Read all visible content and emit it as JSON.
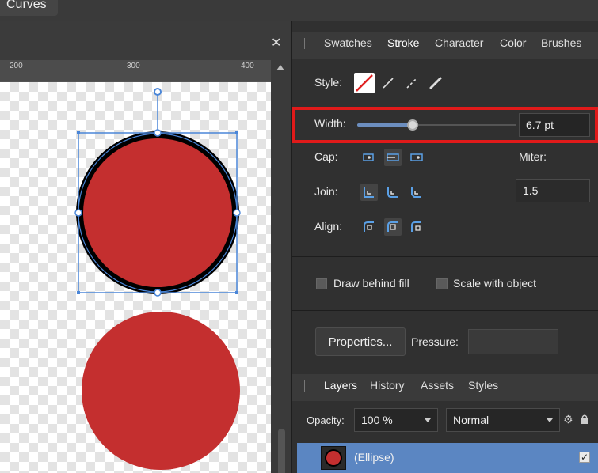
{
  "top_tab": {
    "label": "Curves"
  },
  "ruler": {
    "ticks": [
      "200",
      "300",
      "400"
    ]
  },
  "panel_tabs": [
    {
      "label": "Swatches"
    },
    {
      "label": "Stroke"
    },
    {
      "label": "Character"
    },
    {
      "label": "Color"
    },
    {
      "label": "Brushes"
    }
  ],
  "stroke": {
    "style_label": "Style:",
    "width_label": "Width:",
    "width_value": "6.7 pt",
    "width_fraction": 0.35,
    "cap_label": "Cap:",
    "miter_label": "Miter:",
    "join_label": "Join:",
    "miter_value": "1.5",
    "align_label": "Align:",
    "draw_behind_label": "Draw behind fill",
    "scale_label": "Scale with object",
    "properties_label": "Properties...",
    "pressure_label": "Pressure:"
  },
  "layers_tabs": [
    {
      "label": "Layers"
    },
    {
      "label": "History"
    },
    {
      "label": "Assets"
    },
    {
      "label": "Styles"
    }
  ],
  "layers": {
    "opacity_label": "Opacity:",
    "opacity_value": "100 %",
    "blend_mode": "Normal",
    "items": [
      {
        "name": "(Ellipse)",
        "visible": true
      }
    ]
  },
  "colors": {
    "fill_red": "#c42f2f",
    "selection_blue": "#4a86d8",
    "highlight_red": "#e01a1a"
  },
  "icons": [
    "close-icon",
    "none-stroke-icon",
    "solid-line-icon",
    "dashed-line-icon",
    "brush-line-icon",
    "butt-cap-icon",
    "round-cap-icon",
    "square-cap-icon",
    "miter-join-icon",
    "round-join-icon",
    "bevel-join-icon",
    "align-inside-icon",
    "align-center-icon",
    "align-outside-icon",
    "gear-icon",
    "lock-icon"
  ]
}
